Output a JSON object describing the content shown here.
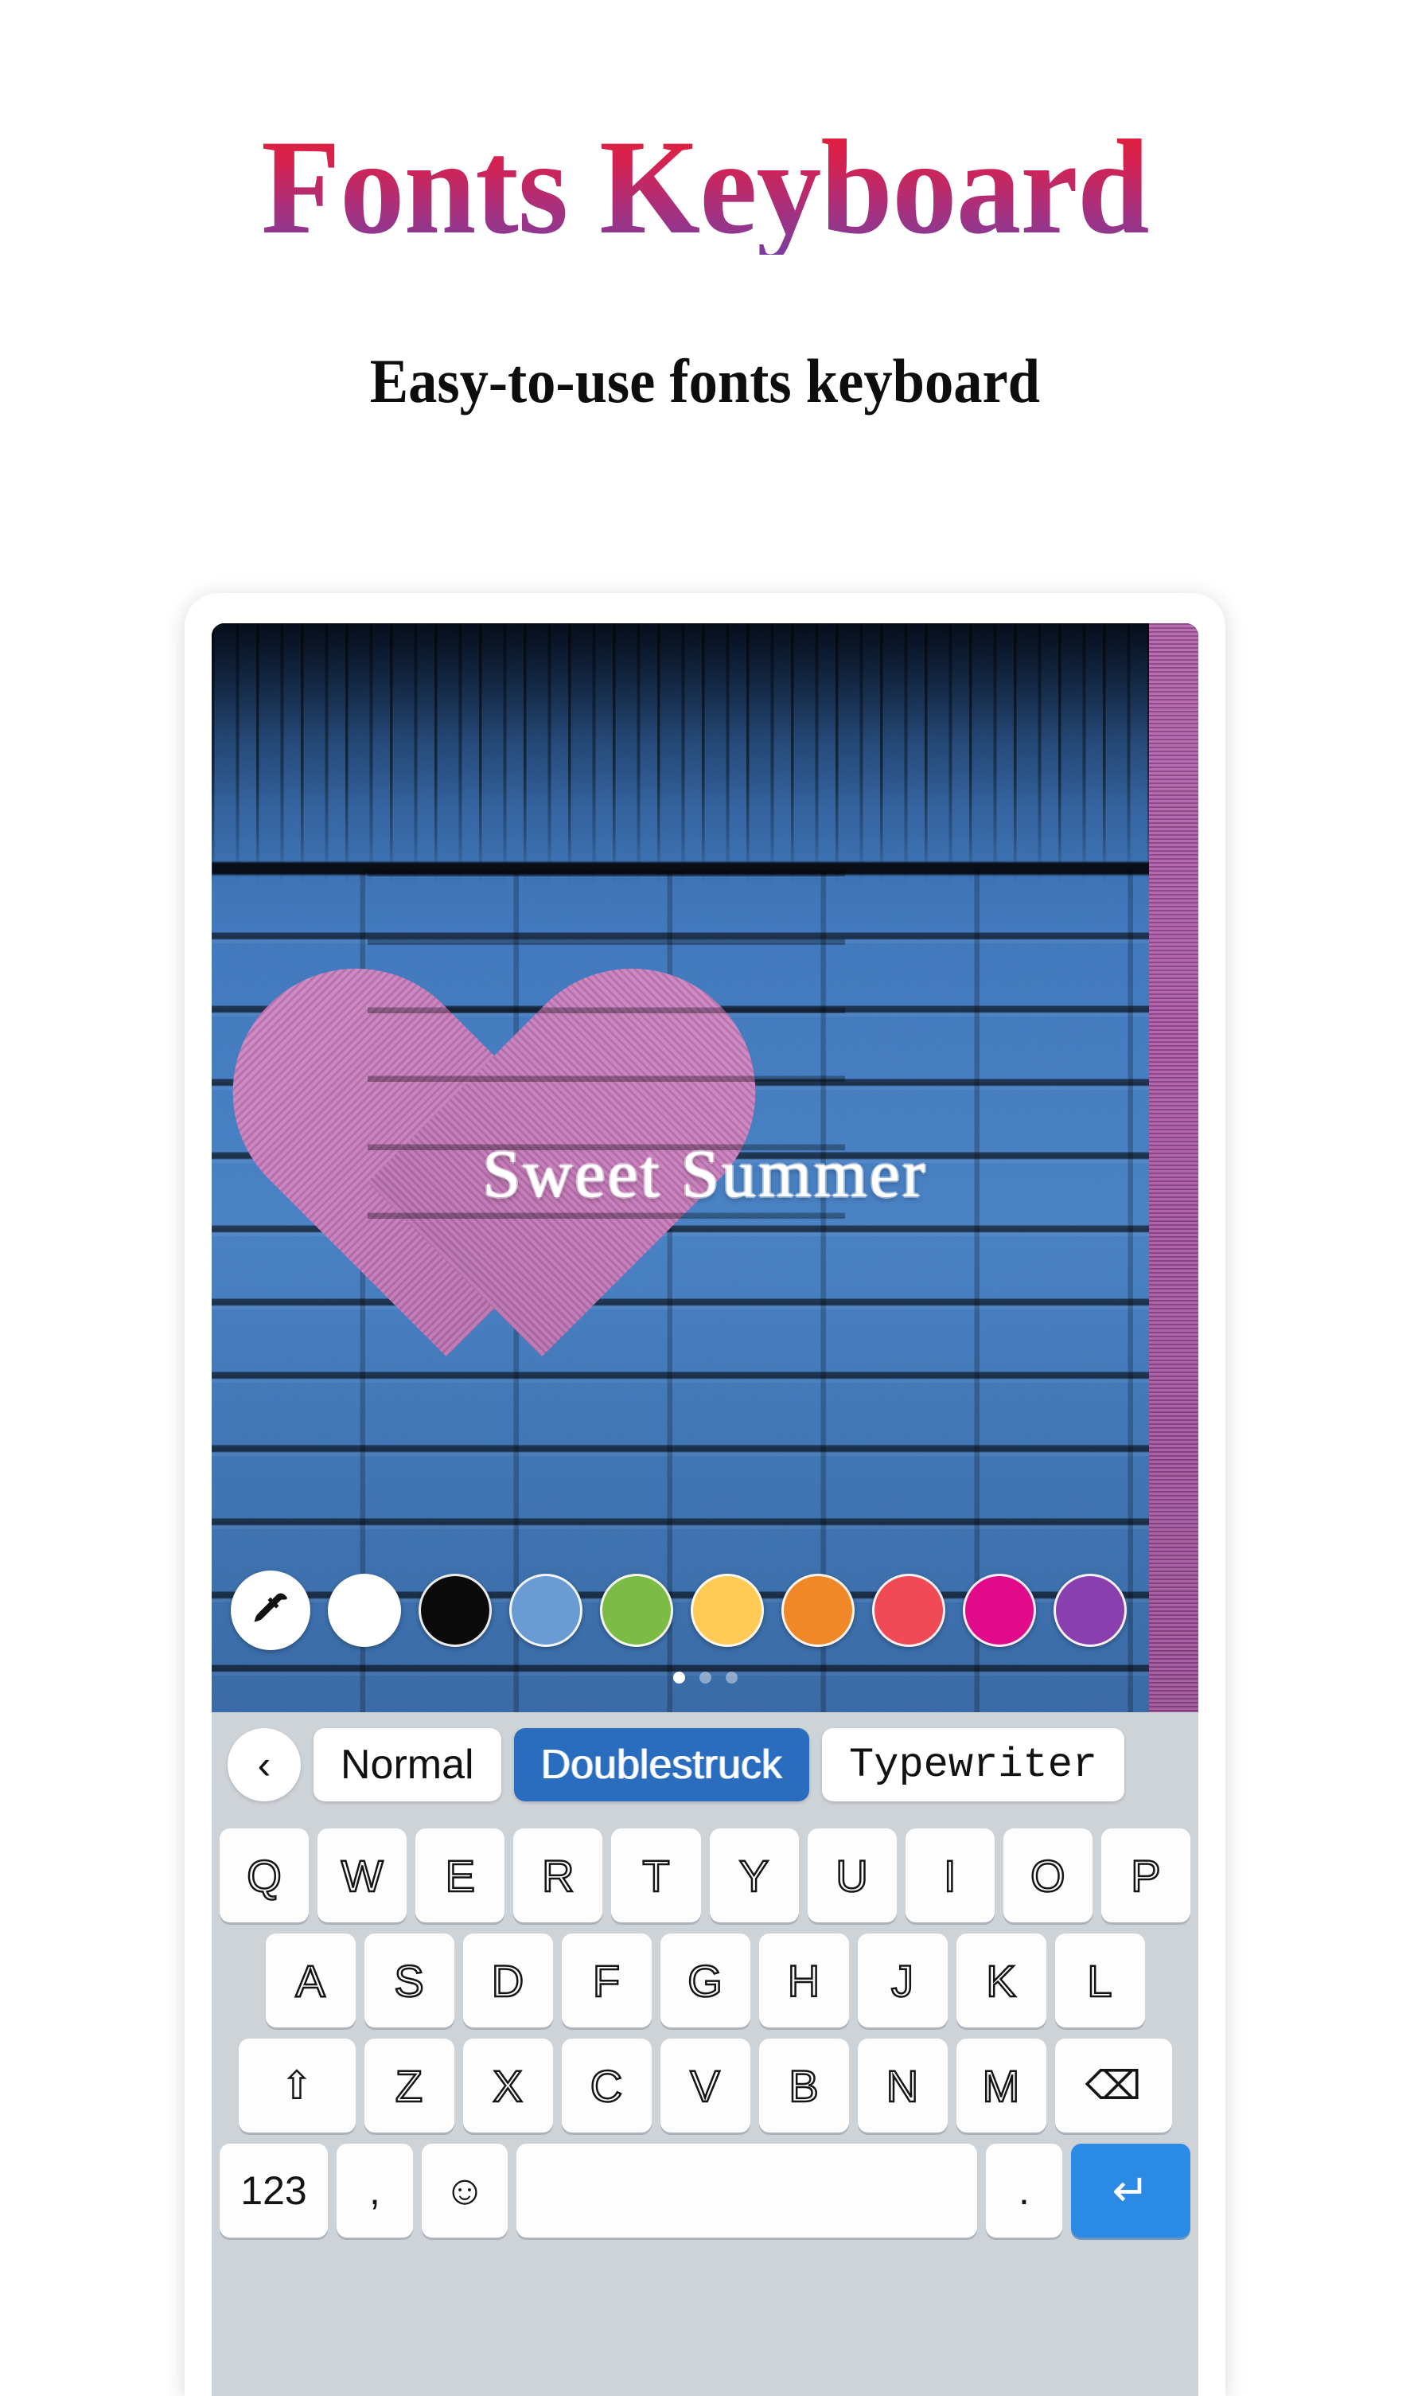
{
  "header": {
    "title": "Fonts Keyboard",
    "subtitle": "Easy-to-use fonts keyboard",
    "title_gradient_from": "#e81f33",
    "title_gradient_to": "#7b3d9e"
  },
  "preview": {
    "overlay_text": "Sweet Summer",
    "background_description": "blue painted brick wall with pink heart",
    "wall_color": "#4279bd",
    "heart_color": "#cc78bf",
    "pink_strip_color": "#aa55a4"
  },
  "colors": {
    "picker_icon": "eyedropper-icon",
    "swatches": [
      {
        "name": "white",
        "hex": "#ffffff"
      },
      {
        "name": "black",
        "hex": "#0a0a0a"
      },
      {
        "name": "light-blue",
        "hex": "#6a9bd2"
      },
      {
        "name": "green",
        "hex": "#7cbb45"
      },
      {
        "name": "yellow",
        "hex": "#ffca55"
      },
      {
        "name": "orange",
        "hex": "#f08828"
      },
      {
        "name": "red",
        "hex": "#ef4a56"
      },
      {
        "name": "magenta",
        "hex": "#e00a8a"
      },
      {
        "name": "purple",
        "hex": "#8a3fae"
      }
    ]
  },
  "pager": {
    "count": 3,
    "active_index": 0
  },
  "font_bar": {
    "back_icon": "chevron-left-icon",
    "chips": [
      {
        "label": "Normal",
        "selected": false
      },
      {
        "label": "Doublestruck",
        "selected": true
      },
      {
        "label": "Typewriter",
        "selected": false
      }
    ],
    "selected_color": "#2a6dbf"
  },
  "keyboard": {
    "row1": [
      "Q",
      "W",
      "E",
      "R",
      "T",
      "Y",
      "U",
      "I",
      "O",
      "P"
    ],
    "row2": [
      "A",
      "S",
      "D",
      "F",
      "G",
      "H",
      "J",
      "K",
      "L"
    ],
    "row3_letters": [
      "Z",
      "X",
      "C",
      "V",
      "B",
      "N",
      "M"
    ],
    "shift_label": "⇧",
    "backspace_label": "⌫",
    "row4": {
      "numbers_label": "123",
      "comma_label": ",",
      "emoji_label": "☺",
      "space_label": "",
      "period_label": ".",
      "enter_label": "↵",
      "enter_color": "#2a8ae4"
    }
  }
}
